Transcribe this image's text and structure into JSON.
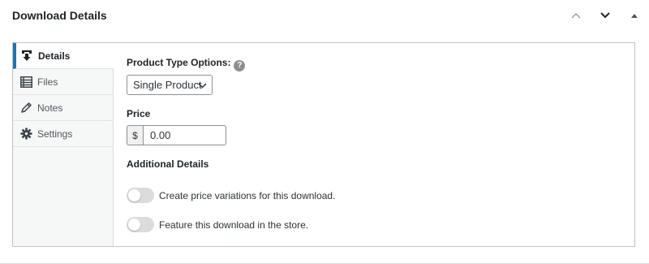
{
  "metabox": {
    "title": "Download Details",
    "controls": [
      {
        "name": "move-up-button",
        "icon": "chevron-up-icon"
      },
      {
        "name": "move-down-button",
        "icon": "chevron-down-icon"
      },
      {
        "name": "toggle-panel-button",
        "icon": "triangle-up-icon"
      }
    ]
  },
  "tabs": [
    {
      "label": "Details",
      "icon": "download-icon",
      "active": true
    },
    {
      "label": "Files",
      "icon": "list-icon",
      "active": false
    },
    {
      "label": "Notes",
      "icon": "pencil-icon",
      "active": false
    },
    {
      "label": "Settings",
      "icon": "gear-icon",
      "active": false
    }
  ],
  "details": {
    "product_type_label": "Product Type Options:",
    "help_glyph": "?",
    "product_type_value": "Single Product",
    "price_label": "Price",
    "currency_symbol": "$",
    "price_value": "0.00",
    "additional_label": "Additional Details",
    "toggles": [
      {
        "label": "Create price variations for this download.",
        "on": false
      },
      {
        "label": "Feature this download in the store.",
        "on": false
      }
    ]
  },
  "colors": {
    "accent": "#2271b1",
    "border": "#c3c4c7",
    "tab_bg": "#f6f7f7",
    "toggle_off": "#dcdcde"
  }
}
